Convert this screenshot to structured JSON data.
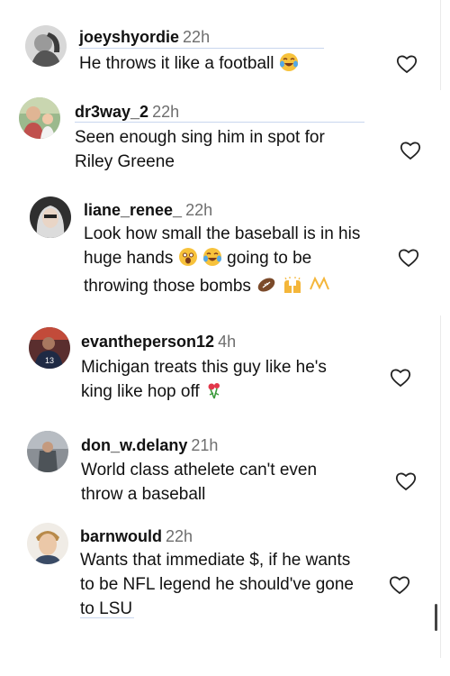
{
  "comments": [
    {
      "username": "joeyshyordie",
      "time": "22h",
      "text": "He throws it like a football",
      "emoji": "laughing-tears"
    },
    {
      "username": "dr3way_2",
      "time": "22h",
      "line1": "Seen enough sing him in spot for",
      "line2": "Riley Greene"
    },
    {
      "username": "liane_renee_",
      "time": "22h",
      "line1": "Look how small the baseball is in his",
      "line2_a": "huge hands",
      "line2_b": "going to be",
      "line3": "throwing those bombs"
    },
    {
      "username": "evantheperson12",
      "time": "4h",
      "line1": "Michigan treats this guy like he's",
      "line2": "king like hop off"
    },
    {
      "username": "don_w.delany",
      "time": "21h",
      "line1": "World class athelete can't even",
      "line2": "throw a baseball"
    },
    {
      "username": "barnwould",
      "time": "22h",
      "line1": "Wants that immediate $, if he wants",
      "line2": "to be NFL legend he should've gone",
      "line3": "to LSU"
    }
  ],
  "colors": {
    "text": "#111111",
    "time": "#6e6e6e",
    "underline": "#c9d6ee",
    "heart": "#222222"
  }
}
